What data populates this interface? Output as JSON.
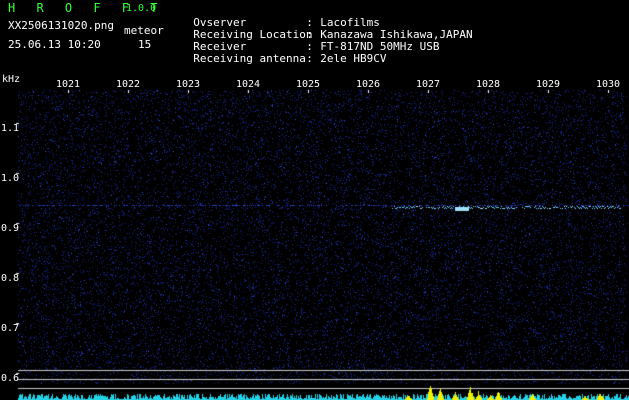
{
  "header": {
    "app_title": "H R O F F T",
    "version": "1.0.0",
    "file_name": "XX2506131020.png",
    "meteor_label": "meteor",
    "datetime": "25.06.13 10:20",
    "meteor_count": "15"
  },
  "info": [
    {
      "key": "Ovserver",
      "sep": ":",
      "value": "Lacofilms"
    },
    {
      "key": "Receiving Location",
      "sep": ":",
      "value": "Kanazawa Ishikawa,JAPAN"
    },
    {
      "key": "Receiver",
      "sep": ":",
      "value": "FT-817ND 50MHz USB"
    },
    {
      "key": "Receiving antenna",
      "sep": ":",
      "value": "2ele HB9CV"
    }
  ],
  "axis": {
    "y_unit": "kHz",
    "x_ticks": [
      "1021",
      "1022",
      "1023",
      "1024",
      "1025",
      "1026",
      "1027",
      "1028",
      "1029",
      "1030"
    ],
    "y_ticks": [
      "1.1",
      "1.0",
      "0.9",
      "0.8",
      "0.7",
      "0.6"
    ]
  },
  "colors": {
    "background": "#000000",
    "noise": "#1a2a9a",
    "echo": "#6fd0ff",
    "activity_bar": "#22d3e8",
    "detection_bar": "#f2f200",
    "header_green": "#33ff33"
  }
}
